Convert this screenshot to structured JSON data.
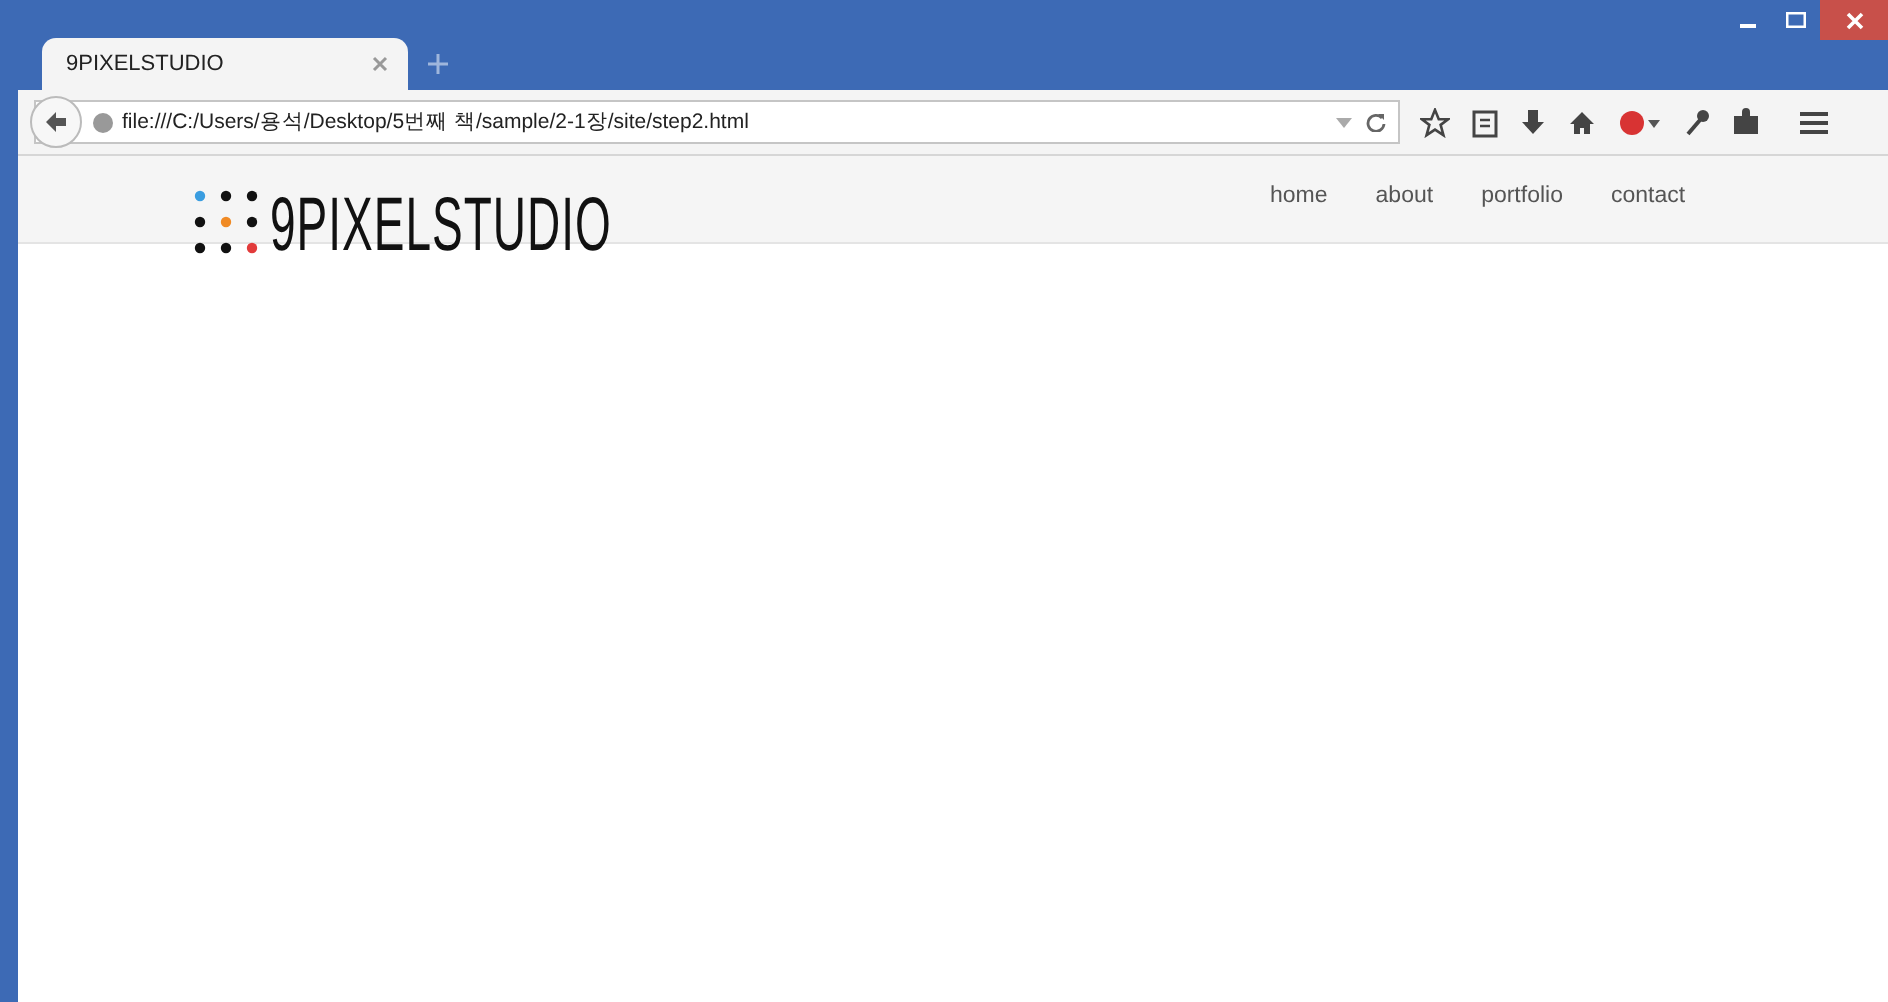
{
  "tabs": [
    {
      "title": "9PIXELSTUDIO"
    }
  ],
  "address_bar": {
    "url": "file:///C:/Users/용석/Desktop/5번째 책/sample/2-1장/site/step2.html"
  },
  "page": {
    "logo": "9PIXELSTUDIO",
    "nav": [
      {
        "label": "home"
      },
      {
        "label": "about"
      },
      {
        "label": "portfolio"
      },
      {
        "label": "contact"
      }
    ]
  }
}
